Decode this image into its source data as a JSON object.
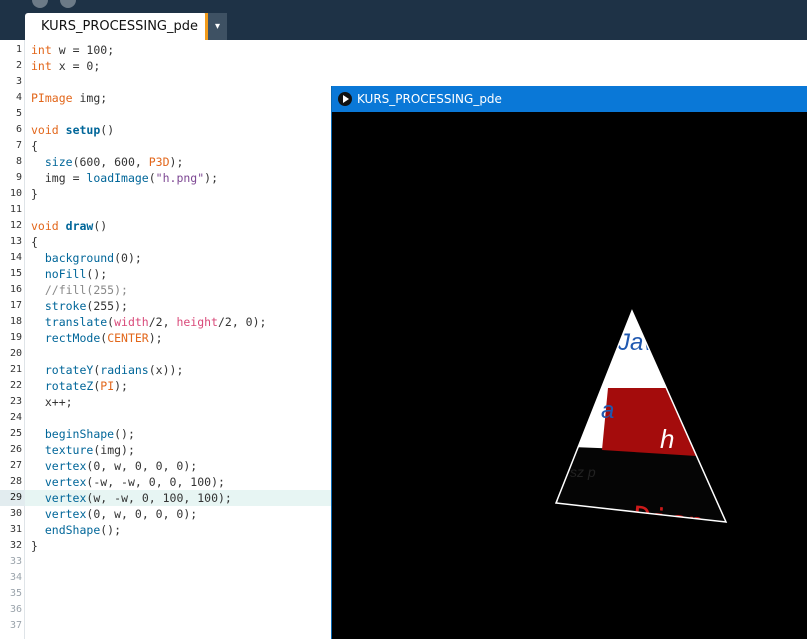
{
  "editor": {
    "tab_label": "KURS_PROCESSING_pde",
    "tab_menu_icon": "▾",
    "current_line": 29,
    "line_numbers": [
      "1",
      "2",
      "3",
      "4",
      "5",
      "6",
      "7",
      "8",
      "9",
      "10",
      "11",
      "12",
      "13",
      "14",
      "15",
      "16",
      "17",
      "18",
      "19",
      "20",
      "21",
      "22",
      "23",
      "24",
      "25",
      "26",
      "27",
      "28",
      "29",
      "30",
      "31",
      "32",
      "33",
      "34",
      "35",
      "36",
      "37"
    ],
    "code_lines": [
      "int w = 100;",
      "int x = 0;",
      "",
      "PImage img;",
      "",
      "void setup()",
      "{",
      "  size(600, 600, P3D);",
      "  img = loadImage(\"h.png\");",
      "}",
      "",
      "void draw()",
      "{",
      "  background(0);",
      "  noFill();",
      "  //fill(255);",
      "  stroke(255);",
      "  translate(width/2, height/2, 0);",
      "  rectMode(CENTER);",
      "",
      "  rotateY(radians(x));",
      "  rotateZ(PI);",
      "  x++;",
      "",
      "  beginShape();",
      "  texture(img);",
      "  vertex(0, w, 0, 0, 0);",
      "  vertex(-w, -w, 0, 0, 100);",
      "  vertex(w, -w, 0, 100, 100);",
      "  vertex(0, w, 0, 0, 0);",
      "  endShape();",
      "}"
    ]
  },
  "sketch_window": {
    "title": "KURS_PROCESSING_pde",
    "play_icon": "play-icon",
    "texture_fragments": [
      "Jav",
      "a",
      "sz p",
      "h",
      "Disp"
    ]
  },
  "colors": {
    "topbar": "#1e3246",
    "tab_accent": "#f29b1a",
    "sketch_titlebar": "#0a78d7",
    "keyword": "#e2661a",
    "function": "#006699",
    "string": "#7d4793",
    "comment": "#888888"
  }
}
